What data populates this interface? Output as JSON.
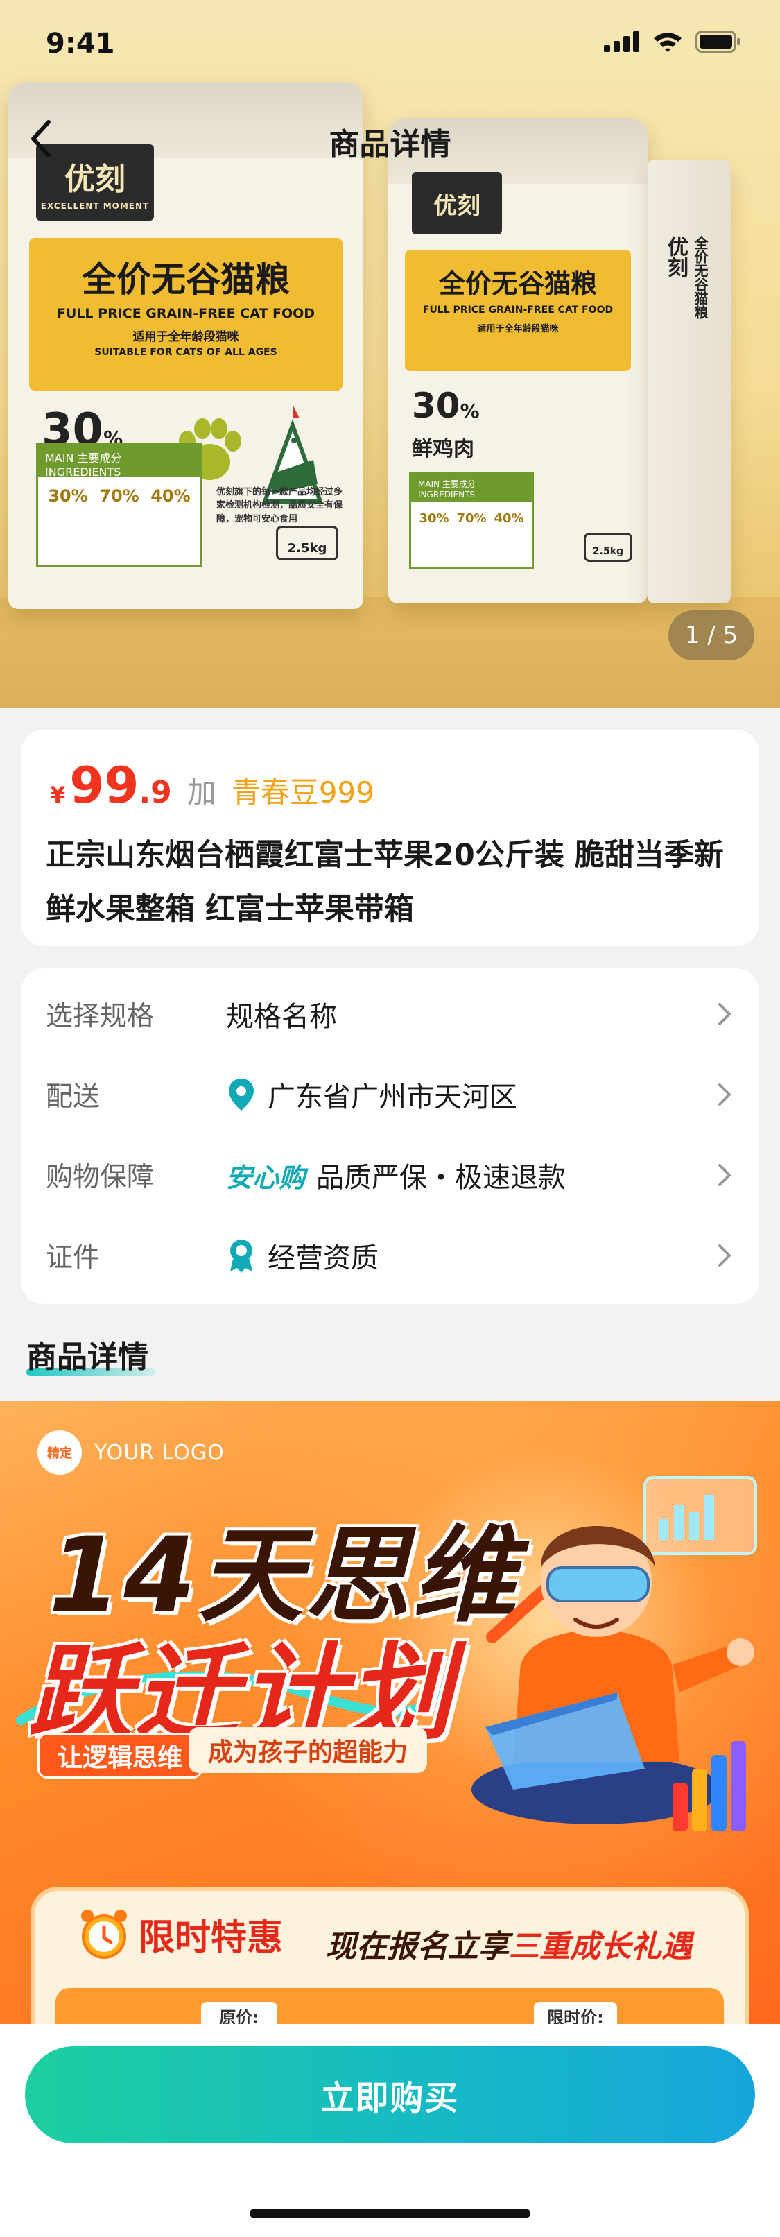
{
  "status_bar": {
    "time": "9:41"
  },
  "nav": {
    "title": "商品详情"
  },
  "gallery": {
    "current": "1",
    "separator": "/",
    "total": "5",
    "bag": {
      "logo": "优刻",
      "logo_sub": "EXCELLENT MOMENT",
      "title_cn": "全价无谷猫粮",
      "title_en": "FULL PRICE GRAIN-FREE CAT FOOD",
      "suitable_cn": "适用于全年龄段猫咪",
      "suitable_en": "SUITABLE FOR CATS OF ALL AGES",
      "percent": "30",
      "percent_sign": "%",
      "meat": "鲜鸡肉",
      "ingredients_label": "MAIN 主要成分 INGREDIENTS",
      "ingredient_values": [
        "30%",
        "70%",
        "40%"
      ],
      "desc": "优刻旗下的每一款产品均经过多家检测机构检测，品质安全有保障，宠物可安心食用",
      "weight": "2.5kg",
      "side_logo": "优刻",
      "side_text": "全价无谷猫粮"
    }
  },
  "price": {
    "symbol": "¥",
    "integer": "99",
    "decimal": ".9",
    "plus_word": "加",
    "beans": "青春豆999"
  },
  "product": {
    "title": "正宗山东烟台栖霞红富士苹果20公斤装 脆甜当季新鲜水果整箱 红富士苹果带箱"
  },
  "info": {
    "spec_label": "选择规格",
    "spec_value": "规格名称",
    "delivery_label": "配送",
    "delivery_value": "广东省广州市天河区",
    "guarantee_label": "购物保障",
    "guarantee_tag": "安心购",
    "guarantee_value": "品质严保・极速退款",
    "license_label": "证件",
    "license_value": "经营资质"
  },
  "detail": {
    "heading": "商品详情"
  },
  "banner": {
    "logo_badge": "精定",
    "logo_text": "YOUR LOGO",
    "title_line1": "14天思维",
    "title_line2": "跃迁计划",
    "pill_a": "让逻辑思维",
    "pill_b": "成为孩子的超能力",
    "limited": "限时特惠",
    "offer_prefix": "现在报名立享",
    "offer_highlight": "三重成长礼遇",
    "original_price_label": "原价:",
    "limited_price_label": "限时价:"
  },
  "actions": {
    "buy_label": "立即购买"
  },
  "colors": {
    "price_red": "#f2331f",
    "beans_orange": "#f5a21b",
    "accent_teal": "#12a9b6",
    "buy_gradient_start": "#1ccfa0",
    "buy_gradient_end": "#16a6db"
  },
  "icons": {
    "back": "chevron-left-icon",
    "chevron": "chevron-right-icon",
    "location": "location-pin-icon",
    "license": "award-ribbon-icon",
    "signal": "signal-icon",
    "wifi": "wifi-icon",
    "battery": "battery-icon"
  }
}
